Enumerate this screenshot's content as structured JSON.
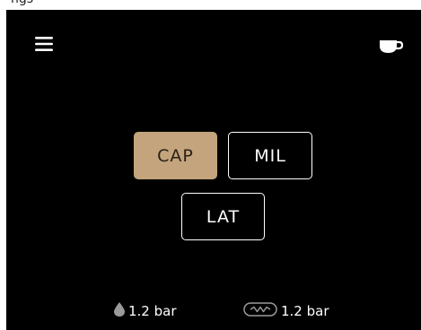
{
  "header": {
    "partial_text": "ngs"
  },
  "drinks": [
    {
      "label": "CAP",
      "selected": true
    },
    {
      "label": "MIL",
      "selected": false
    },
    {
      "label": "LAT",
      "selected": false
    }
  ],
  "status": {
    "water_pressure": "1.2 bar",
    "steam_pressure": "1.2 bar"
  },
  "colors": {
    "accent": "#c3a47c",
    "background": "#000000",
    "foreground": "#ffffff"
  },
  "icons": {
    "menu": "menu-icon",
    "cup": "cup-icon",
    "water": "water-drop-icon",
    "steam": "steam-gauge-icon"
  }
}
